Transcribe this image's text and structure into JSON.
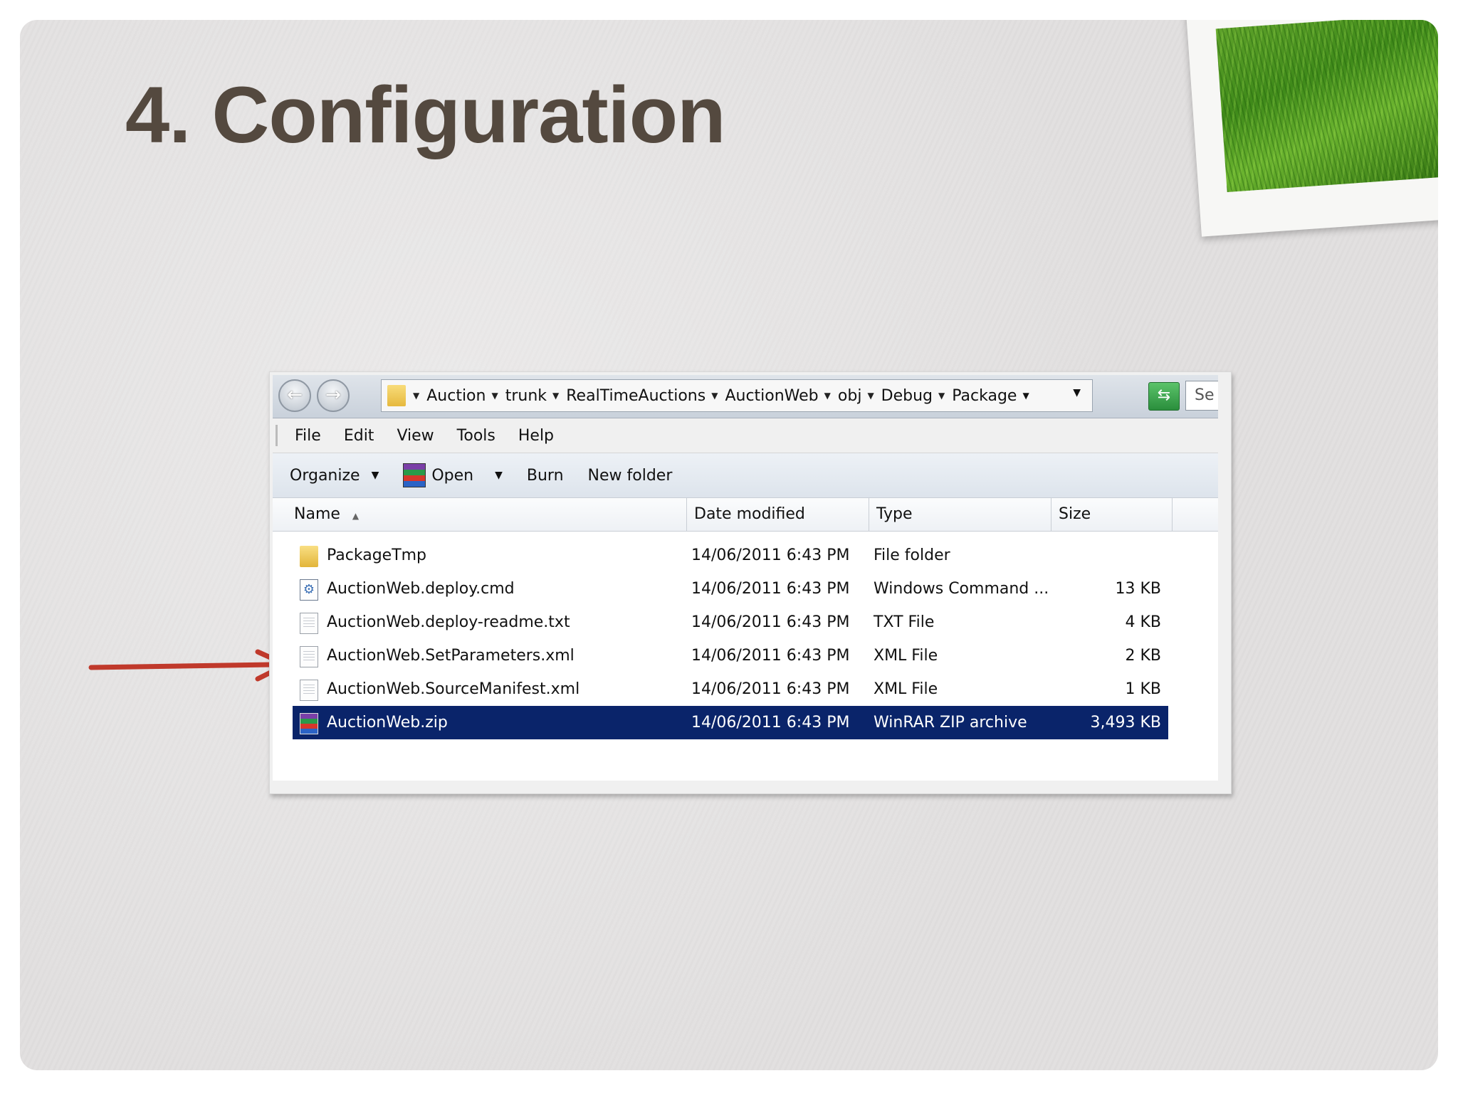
{
  "slide": {
    "title": "4. Configuration"
  },
  "colors": {
    "title": "#54493f",
    "slide_background": "#e1dfdf",
    "arrow": "#c0392b",
    "selection": "#0a246a"
  },
  "explorer": {
    "address_bar": {
      "crumbs": [
        "Auction",
        "trunk",
        "RealTimeAuctions",
        "AuctionWeb",
        "obj",
        "Debug",
        "Package"
      ],
      "search_placeholder": "Se"
    },
    "menu": [
      "File",
      "Edit",
      "View",
      "Tools",
      "Help"
    ],
    "toolbar": {
      "organize": "Organize",
      "open": "Open",
      "burn": "Burn",
      "new_folder": "New folder"
    },
    "columns": {
      "name": "Name",
      "date": "Date modified",
      "type": "Type",
      "size": "Size"
    },
    "files": [
      {
        "icon": "folder-icon",
        "name": "PackageTmp",
        "date": "14/06/2011 6:43 PM",
        "type": "File folder",
        "size": ""
      },
      {
        "icon": "cmd-file-icon",
        "name": "AuctionWeb.deploy.cmd",
        "date": "14/06/2011 6:43 PM",
        "type": "Windows Command ...",
        "size": "13 KB"
      },
      {
        "icon": "text-file-icon",
        "name": "AuctionWeb.deploy-readme.txt",
        "date": "14/06/2011 6:43 PM",
        "type": "TXT File",
        "size": "4 KB"
      },
      {
        "icon": "xml-file-icon",
        "name": "AuctionWeb.SetParameters.xml",
        "date": "14/06/2011 6:43 PM",
        "type": "XML File",
        "size": "2 KB"
      },
      {
        "icon": "xml-file-icon",
        "name": "AuctionWeb.SourceManifest.xml",
        "date": "14/06/2011 6:43 PM",
        "type": "XML File",
        "size": "1 KB"
      },
      {
        "icon": "winrar-zip-icon",
        "name": "AuctionWeb.zip",
        "date": "14/06/2011 6:43 PM",
        "type": "WinRAR ZIP archive",
        "size": "3,493 KB"
      }
    ],
    "selected_file": "AuctionWeb.zip",
    "highlighted_file": "AuctionWeb.SetParameters.xml"
  }
}
